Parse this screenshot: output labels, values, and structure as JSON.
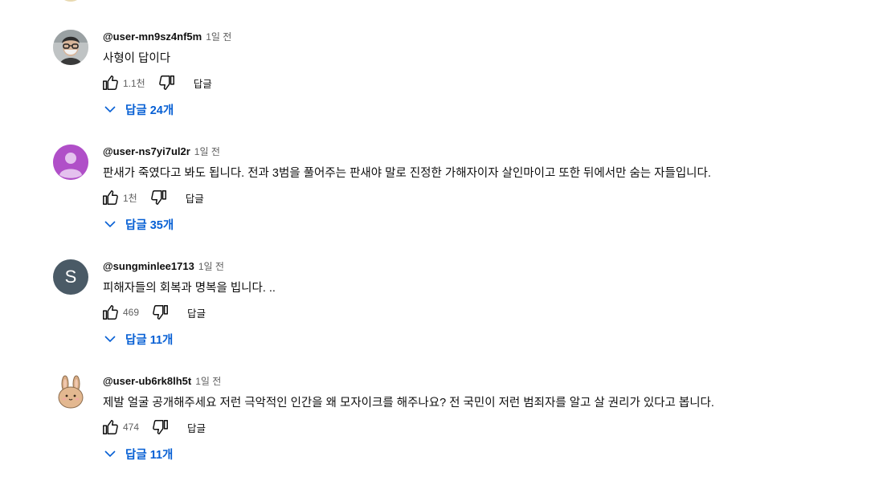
{
  "comments": [
    {
      "author": "@user-mn9sz4nf5m",
      "time": "1일 전",
      "text": "사형이 답이다",
      "likes": "1.1천",
      "reply_label": "답글",
      "replies_label": "답글 24개",
      "avatar": {
        "type": "photo-person",
        "bg": "#c9c9c9"
      }
    },
    {
      "author": "@user-ns7yi7ul2r",
      "time": "1일 전",
      "text": "판새가 죽였다고 봐도 됩니다. 전과 3범을 풀어주는 판새야 말로 진정한 가해자이자 살인마이고 또한 뒤에서만 숨는 자들입니다.",
      "likes": "1천",
      "reply_label": "답글",
      "replies_label": "답글 35개",
      "avatar": {
        "type": "default-person",
        "bg": "#b04fc8"
      }
    },
    {
      "author": "@sungminlee1713",
      "time": "1일 전",
      "text": "피해자들의 회복과 명복을 빕니다.  ..",
      "likes": "469",
      "reply_label": "답글",
      "replies_label": "답글 11개",
      "avatar": {
        "type": "letter",
        "letter": "S",
        "bg": "#4a5a66"
      }
    },
    {
      "author": "@user-ub6rk8lh5t",
      "time": "1일 전",
      "text": "제발 얼굴 공개해주세요 저런 극악적인 인간을 왜 모자이크를 해주나요? 전 국민이 저런 범죄자를 알고 살 권리가 있다고 봅니다.",
      "likes": "474",
      "reply_label": "답글",
      "replies_label": "답글 11개",
      "avatar": {
        "type": "rabbit-illustration",
        "bg": "#ffffff"
      }
    }
  ],
  "colors": {
    "link": "#065fd4",
    "secondary_text": "#606060",
    "primary_text": "#0f0f0f"
  }
}
